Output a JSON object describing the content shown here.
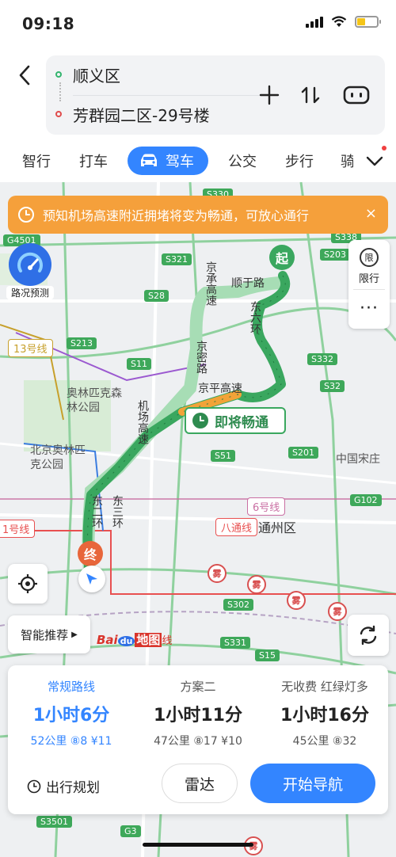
{
  "status": {
    "time": "09:18"
  },
  "route": {
    "from": "顺义区",
    "to": "芳群园二区-29号楼"
  },
  "modes": [
    {
      "label": "智行"
    },
    {
      "label": "打车"
    },
    {
      "label": "驾车"
    },
    {
      "label": "公交"
    },
    {
      "label": "步行"
    },
    {
      "label": "骑"
    }
  ],
  "banner": {
    "text": "预知机场高速附近拥堵将变为畅通，可放心通行",
    "close": "×"
  },
  "map": {
    "traffic_forecast": "路况预测",
    "restriction": {
      "badge": "限",
      "label": "限行"
    },
    "more": "···",
    "smart_recommend": "智能推荐",
    "start_marker": "起",
    "end_marker": "终",
    "ahead_bubble": "即将畅通",
    "baidu_logo": {
      "bai": "Bai",
      "du": "du",
      "rest": "地图",
      "line": "线"
    },
    "road_badges": [
      "S330",
      "S338",
      "G4501",
      "S321",
      "S203",
      "S28",
      "S213",
      "S11",
      "S332",
      "S32",
      "S51",
      "S201",
      "G102",
      "S302",
      "S331",
      "S15",
      "S3501",
      "G3"
    ],
    "line_badges": [
      "13号线",
      "6号线",
      "八通线",
      "1号线"
    ],
    "place_labels": [
      "顺于路",
      "京密路",
      "东六环",
      "京平高速",
      "京承高速",
      "机场高速",
      "东二环",
      "东三环",
      "奥林匹克森林公园",
      "北京奥林匹克公园",
      "通州区",
      "中国宋庄"
    ],
    "fog_label": "雾"
  },
  "plans": [
    {
      "title": "常规路线",
      "time": "1小时6分",
      "meta": "52公里  ⑧8 ¥11"
    },
    {
      "title": "方案二",
      "time": "1小时11分",
      "meta": "47公里  ⑧17 ¥10"
    },
    {
      "title": "无收费  红绿灯多",
      "time": "1小时16分",
      "meta": "45公里  ⑧32"
    }
  ],
  "actions": {
    "plan_trip": "出行规划",
    "radar": "雷达",
    "start_nav": "开始导航"
  },
  "colors": {
    "accent": "#3385ff",
    "route_green": "#3aa75f",
    "banner_orange": "#f5a03b"
  }
}
